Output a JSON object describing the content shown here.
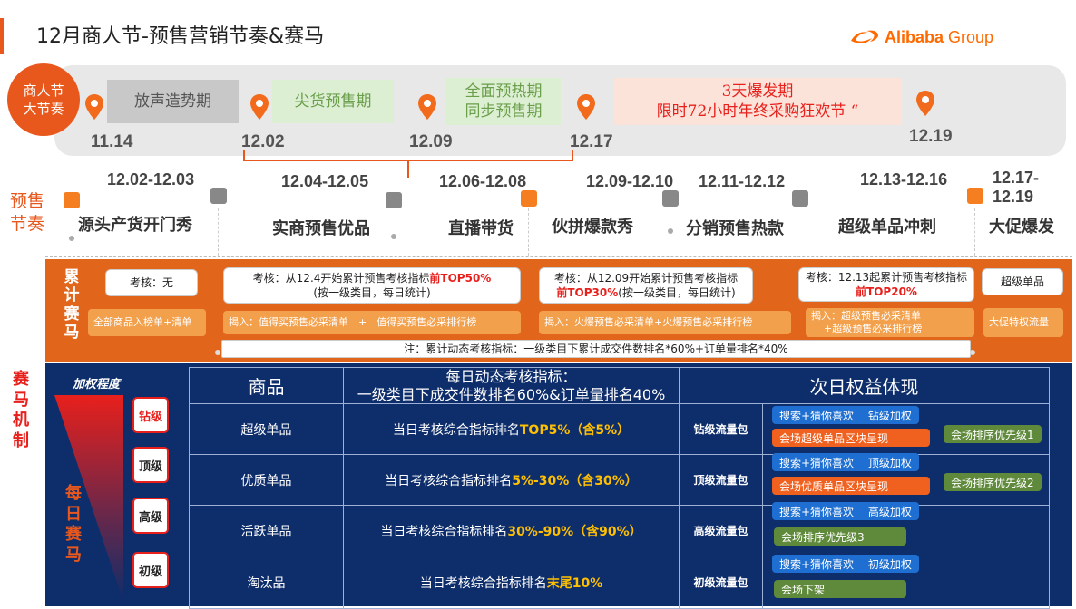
{
  "header": {
    "title": "12月商人节-预售营销节奏&赛马",
    "logo_text": "Alibaba",
    "logo_group": "Group"
  },
  "timeline": {
    "circle_line1": "商人节",
    "circle_line2": "大节奏",
    "phases": [
      {
        "line1": "放声造势期",
        "line2": ""
      },
      {
        "line1": "尖货预售期",
        "line2": ""
      },
      {
        "line1": "全面预热期",
        "line2": "同步预售期"
      },
      {
        "line1": "3天爆发期",
        "line2": "限时72小时年终采购狂欢节 “"
      }
    ],
    "dates": [
      "11.14",
      "12.02",
      "12.09",
      "12.17",
      "12.19"
    ]
  },
  "presale": {
    "label_line1": "预售",
    "label_line2": "节奏",
    "ranges": [
      "12.02-12.03",
      "12.04-12.05",
      "12.06-12.08",
      "12.09-12.10",
      "12.11-12.12",
      "12.13-12.16",
      "12.17-12.19"
    ],
    "titles": [
      "源头产货开门秀",
      "实商预售优品",
      "直播带货",
      "伙拼爆款秀",
      "分销预售热款",
      "超级单品冲刺",
      "大促爆发"
    ]
  },
  "cumulative": {
    "side_label": [
      "累",
      "计",
      "赛",
      "马"
    ],
    "box1": "考核：无",
    "box2_pre": "考核：从12.4开始累计预售考核指标",
    "box2_hl": "前TOP50%",
    "box2_sub": "(按一级类目，每日统计)",
    "box3_pre": "考核：从12.09开始累计预售考核指标",
    "box3_hl": "前TOP30%",
    "box3_sub": "(按一级类目，每日统计)",
    "box4_pre": "考核：12.13起累计预售考核指标",
    "box4_hl": "前TOP20%",
    "box5": "超级单品",
    "lbox1": "全部商品入榜单+清单",
    "lbox2": "揭入：值得买预售必采清单　+　值得买预售必采排行榜",
    "lbox3": "揭入：火爆预售必采清单+火爆预售必采排行榜",
    "lbox4_1": "揭入：超级预售必采清单",
    "lbox4_2": "+超级预售必采排行榜",
    "lbox5": "大促特权流量",
    "note": "注：累计动态考核指标：一级类目下累计成交件数排名*60%+订单量排名*40%"
  },
  "race": {
    "side_label": [
      "赛",
      "马",
      "机",
      "制"
    ],
    "daily_label": [
      "每",
      "日",
      "赛",
      "马"
    ],
    "weight_label": "加权程度",
    "tiers": [
      "钻级",
      "顶级",
      "高级",
      "初级"
    ],
    "headers": {
      "product": "商品",
      "metric_line1": "每日动态考核指标：",
      "metric_line2": "一级类目下成交件数排名60%&订单量排名40%",
      "benefit": "次日权益体现"
    },
    "rows": [
      {
        "product": "超级单品",
        "metric_pre": "当日考核综合指标排名",
        "metric_hl": "TOP5%（含5%）",
        "pack": "钻级流量包",
        "b1": "搜索+猜你喜欢　 钻级加权",
        "b2": "会场超级单品区块呈现",
        "side": "会场排序优先级1"
      },
      {
        "product": "优质单品",
        "metric_pre": "当日考核综合指标排名",
        "metric_hl": "5%-30%（含30%）",
        "pack": "顶级流量包",
        "b1": "搜索+猜你喜欢　 顶级加权",
        "b2": "会场优质单品区块呈现",
        "side": "会场排序优先级2"
      },
      {
        "product": "活跃单品",
        "metric_pre": "当日考核综合指标排名",
        "metric_hl": "30%-90%（含90%）",
        "pack": "高级流量包",
        "b1": "搜索+猜你喜欢　 高级加权",
        "b2": "会场排序优先级3",
        "side": ""
      },
      {
        "product": "淘汰品",
        "metric_pre": "当日考核综合指标排名",
        "metric_hl": "末尾10%",
        "pack": "初级流量包",
        "b1": "搜索+猜你喜欢　 初级加权",
        "b2": "会场下架",
        "side": ""
      }
    ]
  },
  "colors": {
    "accent": "#e8581c",
    "navy": "#0e2d6b",
    "highlight": "#ffc000"
  }
}
